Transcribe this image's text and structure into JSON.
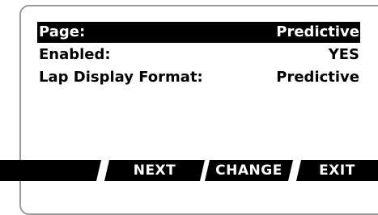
{
  "menu": {
    "rows": [
      {
        "label": "Page:",
        "value": "Predictive"
      },
      {
        "label": "Enabled:",
        "value": "YES"
      },
      {
        "label": "Lap Display Format:",
        "value": "Predictive"
      }
    ]
  },
  "softkeys": {
    "key1": "",
    "key2": "NEXT",
    "key3": "CHANGE",
    "key4": "EXIT"
  },
  "colors": {
    "background": "#ffffff",
    "foreground": "#000000",
    "highlight_bg": "#000000",
    "highlight_fg": "#ffffff",
    "bezel": "#9a9a9a"
  }
}
